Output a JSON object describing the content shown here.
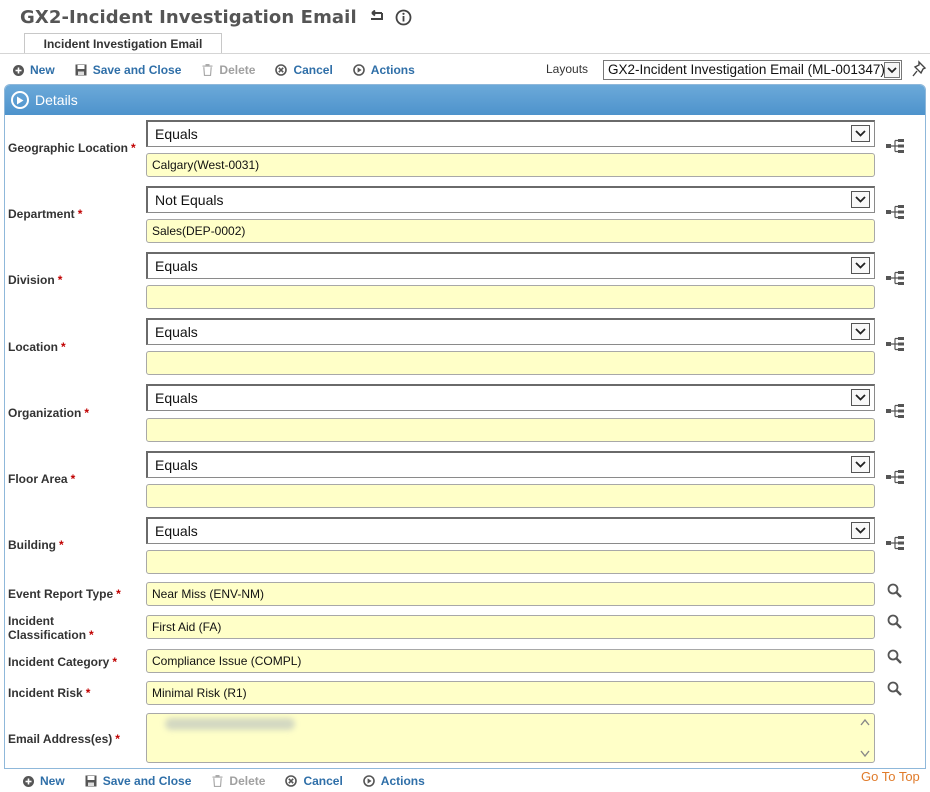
{
  "header": {
    "title": "GX2-Incident Investigation Email",
    "tab_label": "Incident Investigation Email"
  },
  "toolbar": {
    "new": "New",
    "save_close": "Save and Close",
    "delete": "Delete",
    "cancel": "Cancel",
    "actions": "Actions"
  },
  "layouts": {
    "label": "Layouts",
    "selected": "GX2-Incident Investigation Email (ML-001347)"
  },
  "panel": {
    "title": "Details"
  },
  "filters": [
    {
      "label": "Geographic Location",
      "operator": "Equals",
      "value": "Calgary(West-0031)"
    },
    {
      "label": "Department",
      "operator": "Not Equals",
      "value": "Sales(DEP-0002)"
    },
    {
      "label": "Division",
      "operator": "Equals",
      "value": ""
    },
    {
      "label": "Location",
      "operator": "Equals",
      "value": ""
    },
    {
      "label": "Organization",
      "operator": "Equals",
      "value": ""
    },
    {
      "label": "Floor Area",
      "operator": "Equals",
      "value": ""
    },
    {
      "label": "Building",
      "operator": "Equals",
      "value": ""
    }
  ],
  "lookups": [
    {
      "label": "Event Report Type",
      "value": "Near Miss (ENV-NM)"
    },
    {
      "label": "Incident Classification",
      "value": "First Aid (FA)"
    },
    {
      "label": "Incident Category",
      "value": "Compliance Issue (COMPL)"
    },
    {
      "label": "Incident Risk",
      "value": "Minimal Risk (R1)"
    }
  ],
  "email": {
    "label": "Email Address(es)"
  },
  "required_marker": "*",
  "footer": {
    "go_to_top": "Go To Top"
  }
}
